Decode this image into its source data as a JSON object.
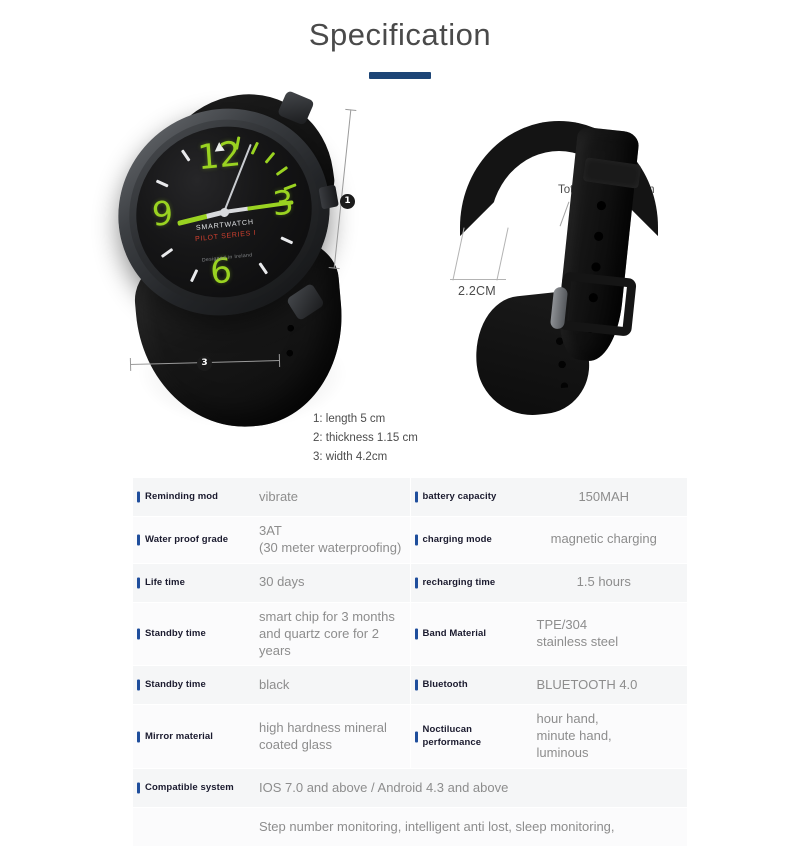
{
  "header": {
    "title": "Specification"
  },
  "figures": {
    "watch": {
      "dial": {
        "hour_12": "12",
        "hour_3": "3",
        "hour_6": "6",
        "hour_9": "9",
        "brand": "SMARTWATCH",
        "series": "PILOT SERIES I",
        "tagline": "Designed  in  Ireland"
      },
      "dimension_badges": {
        "vertical": "1",
        "horizontal": "3"
      },
      "legend": [
        "1: length 5 cm",
        "2: thickness 1.15 cm",
        "3: width 4.2cm"
      ]
    },
    "band": {
      "total_length_label": "Total length 235cm",
      "width_label": "2.2CM"
    }
  },
  "spec_table": {
    "rows": [
      {
        "left": {
          "label": "Reminding mod",
          "value": "vibrate"
        },
        "right": {
          "label": "battery capacity",
          "value": "150MAH"
        }
      },
      {
        "left": {
          "label": "Water\nproof grade",
          "value": "3AT\n (30 meter waterproofing)"
        },
        "right": {
          "label": "charging mode",
          "value": "magnetic charging"
        }
      },
      {
        "left": {
          "label": "Life time",
          "value": "30 days"
        },
        "right": {
          "label": "recharging time",
          "value": "1.5 hours"
        }
      },
      {
        "left": {
          "label": "Standby time",
          "value": "smart chip for 3 months\nand quartz core for 2 years"
        },
        "right": {
          "label": "Band Material",
          "value": "TPE/304\nstainless steel"
        }
      },
      {
        "left": {
          "label": "Standby time",
          "value": "black"
        },
        "right": {
          "label": "Bluetooth",
          "value": "BLUETOOTH 4.0"
        }
      },
      {
        "left": {
          "label": "Mirror material",
          "value": " high hardness mineral\ncoated glass"
        },
        "right": {
          "label": "Noctilucan\nperformance",
          "value": "hour hand,\nminute hand,\nluminous"
        }
      }
    ],
    "full_rows": [
      {
        "label": "Compatible\n system",
        "value": "IOS 7.0 and above / Android 4.3 and above"
      }
    ],
    "note_row": {
      "value": "Step number monitoring, intelligent anti lost, sleep monitoring,"
    }
  },
  "colors": {
    "accent_blue": "#1f4e9c",
    "title_rule": "#1d4576",
    "lume_green": "#9ad321",
    "series_red": "#d2402f",
    "row_tint_a": "#f5f6f7",
    "row_tint_b": "#fbfbfc"
  }
}
